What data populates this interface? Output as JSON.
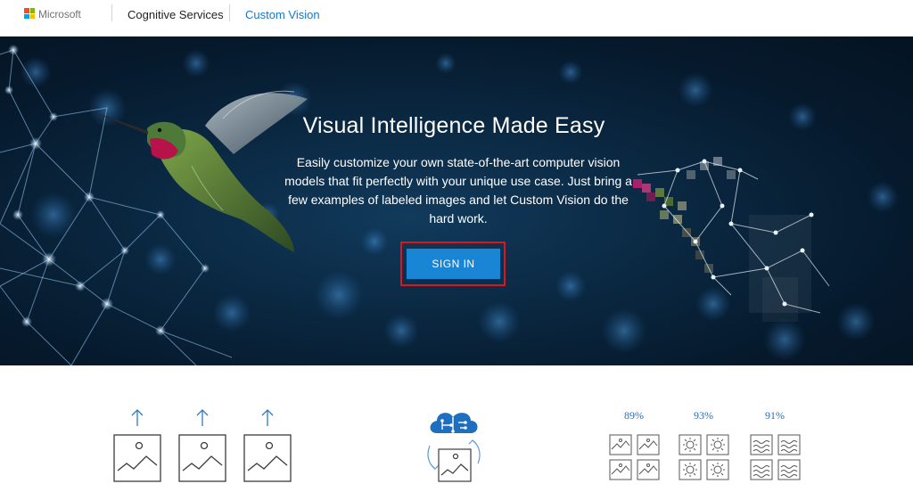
{
  "header": {
    "brand": "Microsoft",
    "nav": [
      {
        "label": "Cognitive Services"
      },
      {
        "label": "Custom Vision"
      }
    ],
    "colors": {
      "red": "#f25022",
      "green": "#7fba00",
      "blue": "#00a4ef",
      "yellow": "#ffb900",
      "active_link": "#1a76c5"
    }
  },
  "hero": {
    "title": "Visual Intelligence Made Easy",
    "description_lines": [
      "Easily customize your own state-of-the-art computer vision",
      "models that fit perfectly with your unique use case. Just bring a",
      "few examples of labeled images and let Custom Vision do the",
      "hard work."
    ],
    "cta_label": "SIGN IN",
    "cta_color": "#1a85d4",
    "highlight_color": "#e0141b"
  },
  "features": {
    "upload_icons": [
      "upload-image-icon",
      "upload-image-icon",
      "upload-image-icon"
    ],
    "train_icon": "brain-cloud-icon",
    "accuracies": [
      "89%",
      "93%",
      "91%"
    ]
  }
}
